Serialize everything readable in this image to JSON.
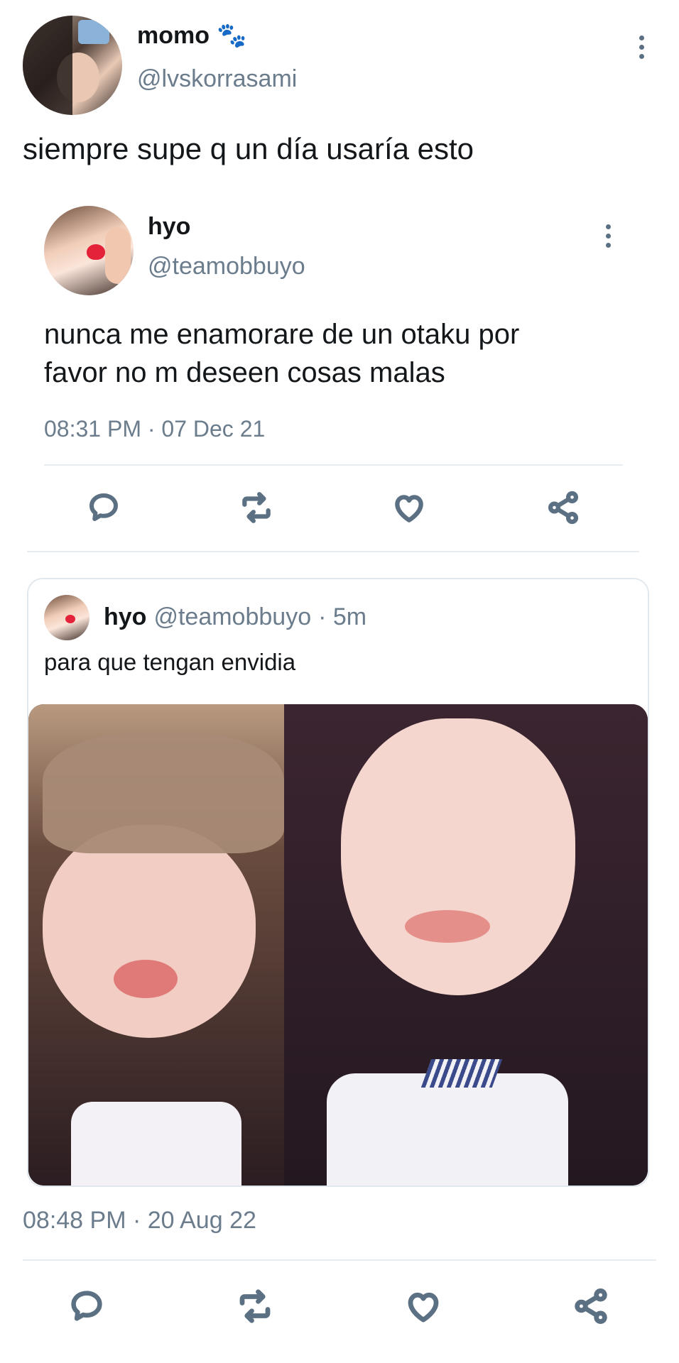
{
  "main_tweet": {
    "display_name": "momo",
    "emoji": "🐾",
    "handle": "@lvskorrasami",
    "text": "siempre supe q un día usaría esto",
    "timestamp": "08:48 PM · 20 Aug 22"
  },
  "embedded_tweet": {
    "display_name": "hyo",
    "handle": "@teamobbuyo",
    "text": "nunca me enamorare de un otaku por favor no m deseen cosas malas",
    "timestamp": "08:31 PM · 07 Dec 21"
  },
  "quoted_tweet": {
    "display_name": "hyo",
    "handle": "@teamobbuyo",
    "age": "· 5m",
    "text": "para que tengan envidia"
  },
  "actions": [
    "reply-icon",
    "retweet-icon",
    "like-icon",
    "share-icon"
  ],
  "colors": {
    "text": "#14171a",
    "muted": "#6b7c8c",
    "divider": "#e6ecf0",
    "icon": "#5b7083"
  }
}
